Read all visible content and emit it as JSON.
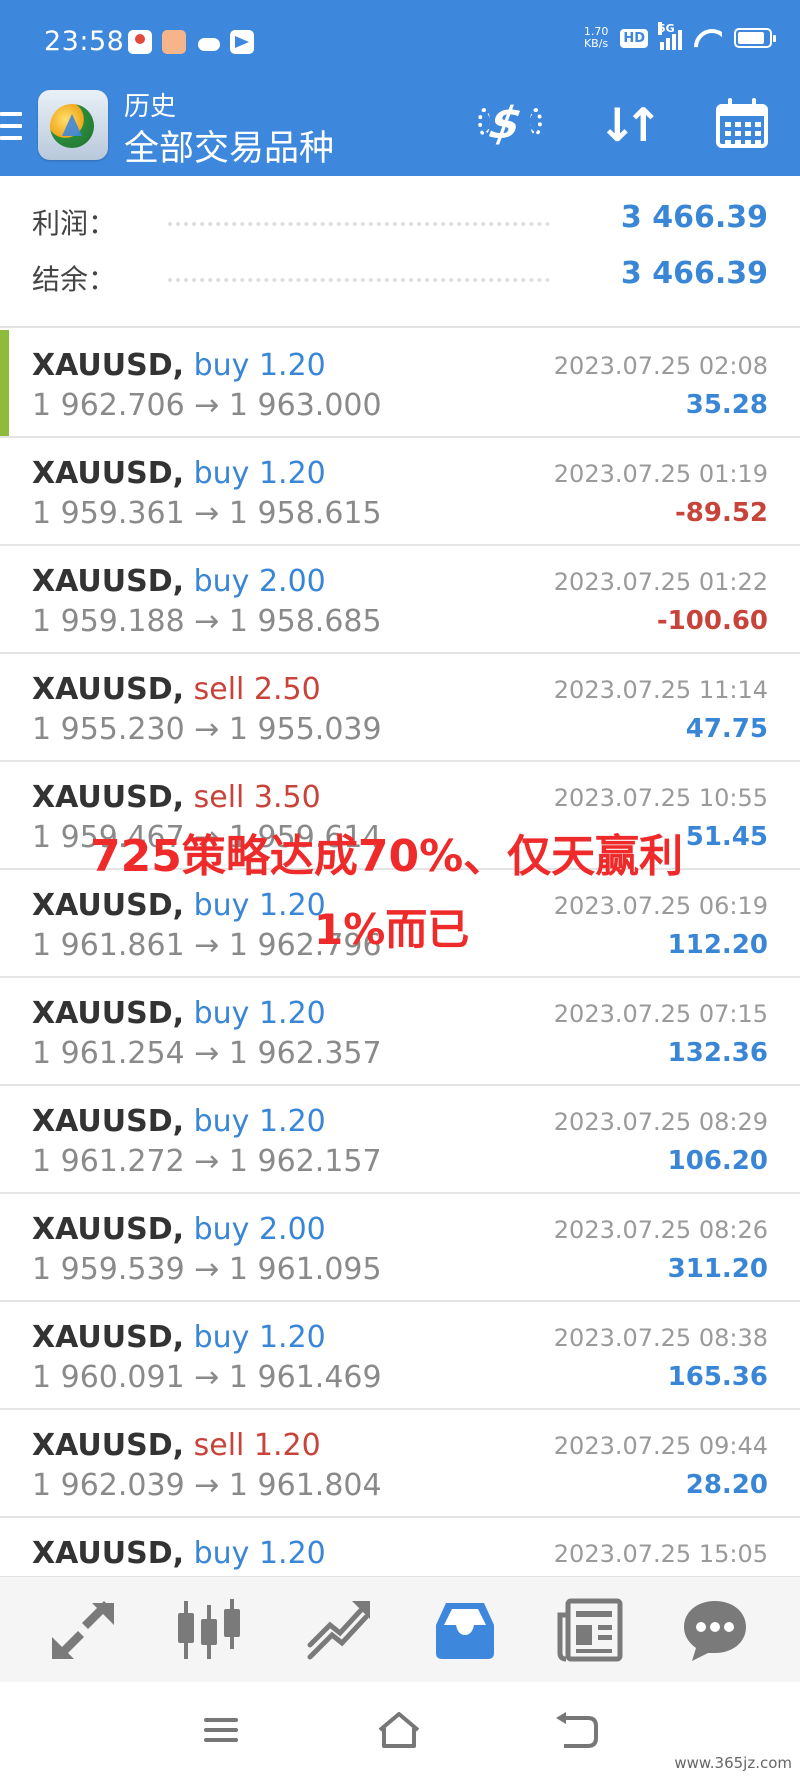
{
  "status_bar": {
    "time": "23:58",
    "net_speed_value": "1.70",
    "net_speed_unit": "KB/s",
    "hd": "HD",
    "signal": "5G"
  },
  "app_bar": {
    "subtitle": "历史",
    "title": "全部交易品种",
    "icons": [
      "menu-icon",
      "dollar-refresh-icon",
      "sort-icon",
      "calendar-icon"
    ]
  },
  "summary": {
    "profit_label": "利润：",
    "profit_value": "3 466.39",
    "balance_label": "结余：",
    "balance_value": "3 466.39"
  },
  "colors": {
    "accent": "#3d87dd",
    "positive": "#3a86d6",
    "negative": "#c8443b",
    "active_marker": "#8dbb3c",
    "overlay": "#ee2a2a"
  },
  "trades": [
    {
      "symbol": "XAUUSD,",
      "type": "buy",
      "volume": "1.20",
      "open": "1 962.706",
      "close": "1 963.000",
      "date": "2023.07.25 02:08",
      "profit": "35.28"
    },
    {
      "symbol": "XAUUSD,",
      "type": "buy",
      "volume": "1.20",
      "open": "1 959.361",
      "close": "1 958.615",
      "date": "2023.07.25 01:19",
      "profit": "-89.52"
    },
    {
      "symbol": "XAUUSD,",
      "type": "buy",
      "volume": "2.00",
      "open": "1 959.188",
      "close": "1 958.685",
      "date": "2023.07.25 01:22",
      "profit": "-100.60"
    },
    {
      "symbol": "XAUUSD,",
      "type": "sell",
      "volume": "2.50",
      "open": "1 955.230",
      "close": "1 955.039",
      "date": "2023.07.25 11:14",
      "profit": "47.75"
    },
    {
      "symbol": "XAUUSD,",
      "type": "sell",
      "volume": "3.50",
      "open": "1 959.467",
      "close": "1 959.614",
      "date": "2023.07.25 10:55",
      "profit": "51.45"
    },
    {
      "symbol": "XAUUSD,",
      "type": "buy",
      "volume": "1.20",
      "open": "1 961.861",
      "close": "1 962.796",
      "date": "2023.07.25 06:19",
      "profit": "112.20"
    },
    {
      "symbol": "XAUUSD,",
      "type": "buy",
      "volume": "1.20",
      "open": "1 961.254",
      "close": "1 962.357",
      "date": "2023.07.25 07:15",
      "profit": "132.36"
    },
    {
      "symbol": "XAUUSD,",
      "type": "buy",
      "volume": "1.20",
      "open": "1 961.272",
      "close": "1 962.157",
      "date": "2023.07.25 08:29",
      "profit": "106.20"
    },
    {
      "symbol": "XAUUSD,",
      "type": "buy",
      "volume": "2.00",
      "open": "1 959.539",
      "close": "1 961.095",
      "date": "2023.07.25 08:26",
      "profit": "311.20"
    },
    {
      "symbol": "XAUUSD,",
      "type": "buy",
      "volume": "1.20",
      "open": "1 960.091",
      "close": "1 961.469",
      "date": "2023.07.25 08:38",
      "profit": "165.36"
    },
    {
      "symbol": "XAUUSD,",
      "type": "sell",
      "volume": "1.20",
      "open": "1 962.039",
      "close": "1 961.804",
      "date": "2023.07.25 09:44",
      "profit": "28.20"
    },
    {
      "symbol": "XAUUSD,",
      "type": "buy",
      "volume": "1.20",
      "open": "",
      "close": "",
      "date": "2023.07.25 15:05",
      "profit": ""
    }
  ],
  "arrow": "→",
  "overlay": {
    "line1": "725策略达成70%、仅天赢利",
    "line2": "1%而已"
  },
  "bottom_nav": [
    "quotes-icon",
    "chart-icon",
    "trade-icon",
    "history-icon",
    "news-icon",
    "chat-icon"
  ],
  "system_nav": [
    "recents-icon",
    "home-icon",
    "back-icon"
  ],
  "watermark": "www.365jz.com"
}
